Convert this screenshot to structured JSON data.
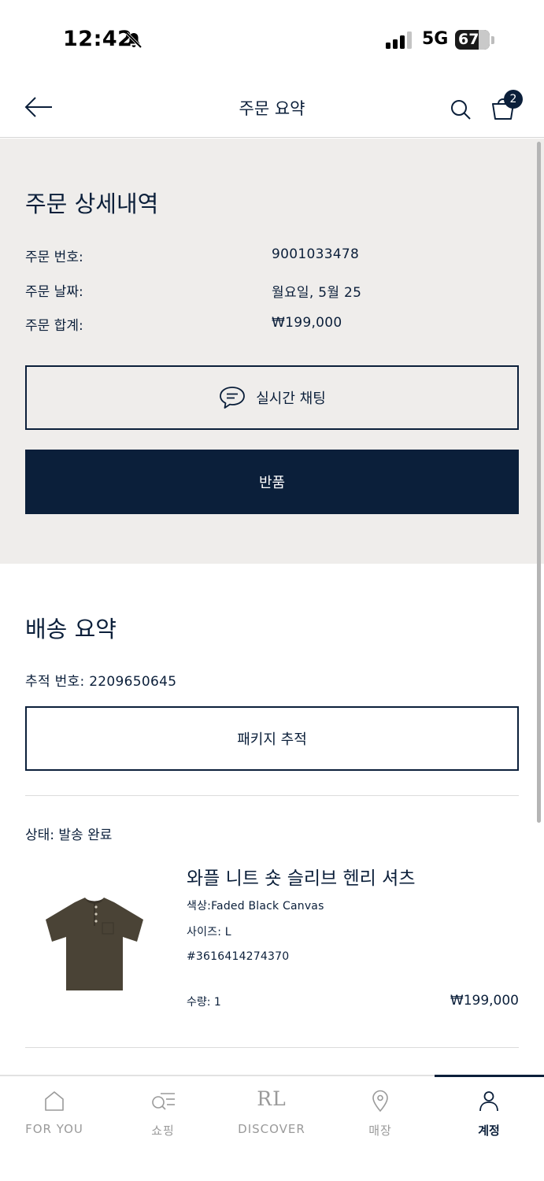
{
  "status_bar": {
    "time": "12:42",
    "network": "5G",
    "battery": "67"
  },
  "header": {
    "title": "주문 요약",
    "cart_count": "2"
  },
  "order_details": {
    "title": "주문 상세내역",
    "rows": [
      {
        "label": "주문 번호:",
        "value": "9001033478"
      },
      {
        "label": "주문 날짜:",
        "value": "월요일, 5월 25"
      },
      {
        "label": "주문 합계:",
        "value": "₩199,000"
      }
    ],
    "chat_button": "실시간 채팅",
    "return_button": "반품"
  },
  "shipping": {
    "title": "배송 요약",
    "tracking": "추적 번호: 2209650645",
    "track_button": "패키지 추적",
    "status": "상태: 발송 완료",
    "product": {
      "name": "와플 니트 숏 슬리브 헨리 셔츠",
      "color": "색상:Faded Black Canvas",
      "size": "사이즈: L",
      "sku": "#3616414274370",
      "quantity": "수량: 1",
      "price": "₩199,000"
    }
  },
  "tabs": [
    {
      "label": "FOR YOU",
      "icon": "home-icon"
    },
    {
      "label": "쇼핑",
      "icon": "shop-search-icon"
    },
    {
      "label": "DISCOVER",
      "icon": "rl-logo",
      "logo_text": "RL"
    },
    {
      "label": "매장",
      "icon": "location-pin-icon"
    },
    {
      "label": "계정",
      "icon": "person-icon",
      "active": true
    }
  ],
  "colors": {
    "navy": "#0b1f3a",
    "section_bg": "#efedeb",
    "inactive_tab": "#9a9a9a"
  }
}
